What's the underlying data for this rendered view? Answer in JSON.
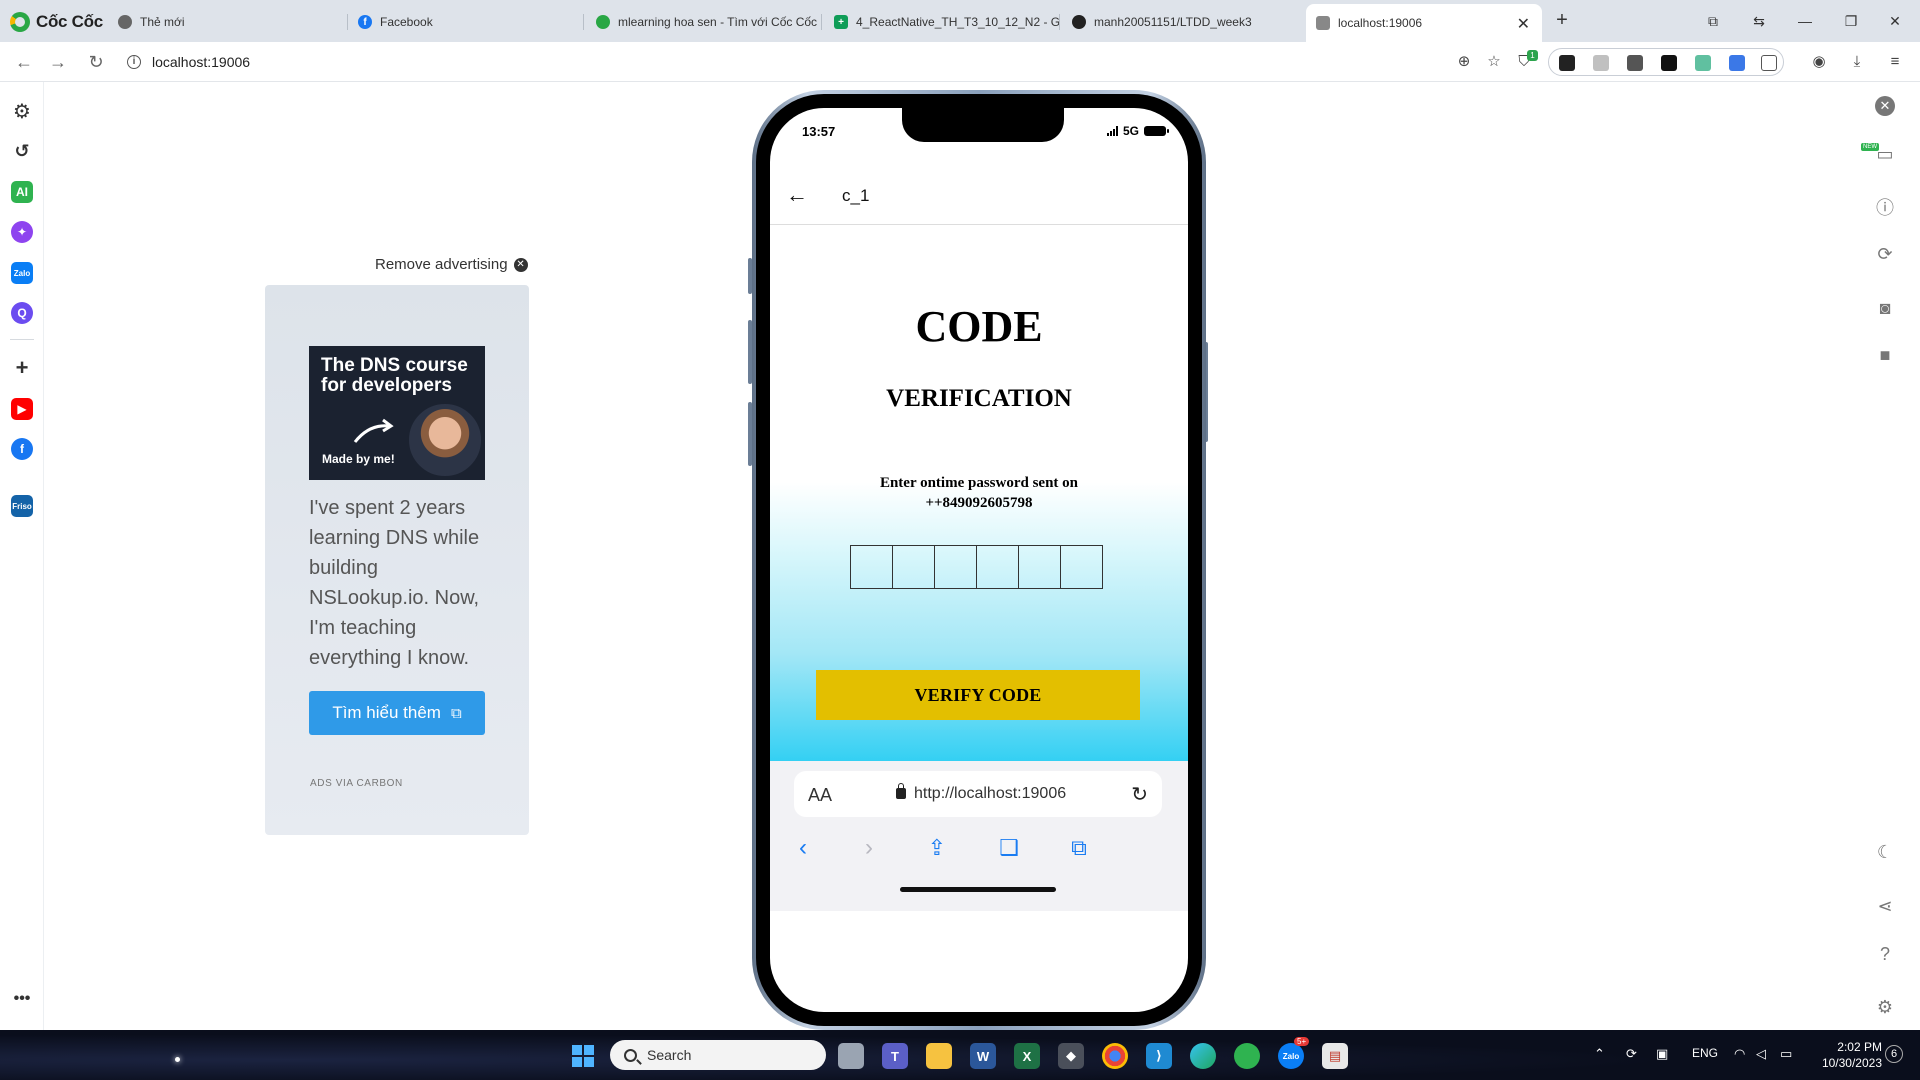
{
  "browser": {
    "brand_name": "Cốc Cốc",
    "tabs": [
      {
        "label": "Thẻ mới",
        "icon": "coccoc-icon"
      },
      {
        "label": "Facebook",
        "icon": "facebook-icon"
      },
      {
        "label": "mlearning hoa sen - Tìm với Cốc Cốc",
        "icon": "coccoc-search-icon"
      },
      {
        "label": "4_ReactNative_TH_T3_10_12_N2 - Go",
        "icon": "sheets-icon"
      },
      {
        "label": "manh20051151/LTDD_week3",
        "icon": "github-icon"
      },
      {
        "label": "localhost:19006",
        "icon": "expo-icon"
      }
    ],
    "url": "localhost:19006",
    "extension_badge": "1",
    "colors": {
      "accent": "#1a73e8",
      "tab_strip": "#dee3ea"
    }
  },
  "ad": {
    "remove_label": "Remove advertising",
    "image_title": "The DNS course for developers",
    "image_sub": "Made by me!",
    "text": "I've spent 2 years learning DNS while building NSLookup.io. Now, I'm teaching everything I know.",
    "button_label": "Tìm hiểu thêm",
    "via_label": "ADS VIA CARBON"
  },
  "phone": {
    "status_time": "13:57",
    "network": "5G",
    "header_title": "c_1",
    "code_title": "CODE",
    "verification_title": "VERIFICATION",
    "otp_message_line1": "Enter ontime password sent on",
    "otp_message_line2": "++849092605798",
    "otp_digits": [
      "",
      "",
      "",
      "",
      "",
      ""
    ],
    "verify_button": "VERIFY CODE",
    "safari_aa": "AA",
    "safari_url": "http://localhost:19006",
    "colors": {
      "button": "#e3bf00",
      "gradient_bottom": "#34d0f3",
      "safari_tint": "#1a7cf2"
    }
  },
  "devtools_rail": {
    "new_badge": "NEW"
  },
  "taskbar": {
    "search_placeholder": "Search",
    "language": "ENG",
    "time": "2:02 PM",
    "date": "10/30/2023",
    "zalo_badge": "5+",
    "notification_count": "6"
  }
}
